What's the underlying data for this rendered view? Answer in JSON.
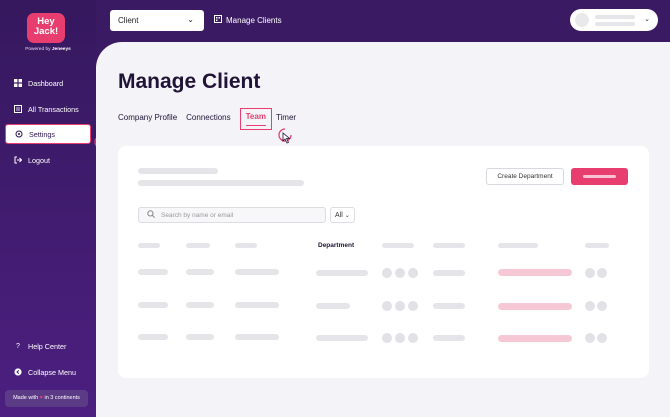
{
  "brand": {
    "logo_line1": "Hey",
    "logo_line2": "Jack!",
    "powered_prefix": "Powered by",
    "powered_brand": "Jeneeys"
  },
  "sidebar": {
    "items": [
      {
        "label": "Dashboard",
        "icon": "grid-icon"
      },
      {
        "label": "All Transactions",
        "icon": "list-icon"
      },
      {
        "label": "Settings",
        "icon": "gear-icon",
        "active": true
      },
      {
        "label": "Logout",
        "icon": "logout-icon"
      }
    ],
    "bottom": [
      {
        "label": "Help Center",
        "icon": "question-icon"
      },
      {
        "label": "Collapse Menu",
        "icon": "collapse-icon"
      }
    ],
    "made_with": {
      "prefix": "Made with",
      "suffix": "in 3 continents"
    }
  },
  "topbar": {
    "client_select": "Client",
    "manage_link": "Manage Clients"
  },
  "main": {
    "title": "Manage Client",
    "tabs": [
      "Company Profile",
      "Connections",
      "Team",
      "Timer"
    ],
    "active_tab": "Team",
    "create_button": "Create Department",
    "search_placeholder": "Search by name or email",
    "filter_value": "All",
    "department_header": "Department"
  },
  "colors": {
    "accent": "#e83d6f",
    "sidebar": "#3a1a63",
    "background": "#f4f3f7"
  }
}
